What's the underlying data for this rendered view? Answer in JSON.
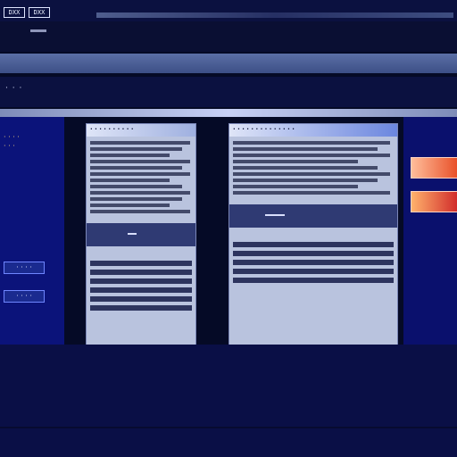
{
  "topbar": {
    "brand_marks": [
      "DXX",
      "DXX"
    ]
  },
  "header": {
    "nav_text": "· · ·"
  },
  "sidebar_left": {
    "label1": "· · · ·",
    "label2": "· · ·",
    "button1": "· · · ·",
    "button2": "· · · ·"
  },
  "documents": [
    {
      "title": "· · · · · · · · · ·"
    },
    {
      "title": "· · · · · · · · · · · · · ·"
    }
  ],
  "colors": {
    "background": "#050a26",
    "panel_blue": "#0b137a",
    "accent_orange": "#e84f28"
  }
}
